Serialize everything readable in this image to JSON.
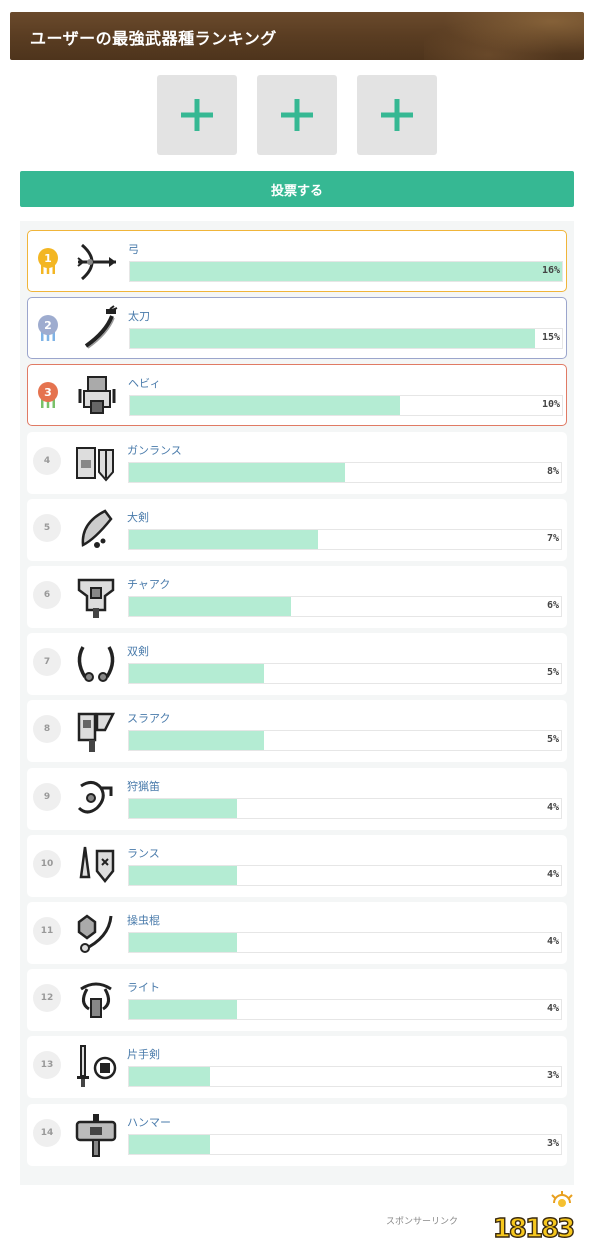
{
  "header": {
    "title": "ユーザーの最強武器種ランキング"
  },
  "slots": [
    {
      "icon": "plus-icon"
    },
    {
      "icon": "plus-icon"
    },
    {
      "icon": "plus-icon"
    }
  ],
  "vote_button": {
    "label": "投票する"
  },
  "colors": {
    "accent": "#36b893",
    "bar": "#b4ecd3",
    "gold": "#f0b53a",
    "silver": "#9ba5cc",
    "bronze": "#e07a64"
  },
  "ranking": [
    {
      "rank": "1",
      "name": "弓",
      "percent": 16,
      "percent_label": "16%",
      "icon": "bow-icon"
    },
    {
      "rank": "2",
      "name": "太刀",
      "percent": 15,
      "percent_label": "15%",
      "icon": "long-sword-icon"
    },
    {
      "rank": "3",
      "name": "ヘビィ",
      "percent": 10,
      "percent_label": "10%",
      "icon": "heavy-bowgun-icon"
    },
    {
      "rank": "4",
      "name": "ガンランス",
      "percent": 8,
      "percent_label": "8%",
      "icon": "gunlance-icon"
    },
    {
      "rank": "5",
      "name": "大剣",
      "percent": 7,
      "percent_label": "7%",
      "icon": "great-sword-icon"
    },
    {
      "rank": "6",
      "name": "チャアク",
      "percent": 6,
      "percent_label": "6%",
      "icon": "charge-blade-icon"
    },
    {
      "rank": "7",
      "name": "双剣",
      "percent": 5,
      "percent_label": "5%",
      "icon": "dual-blades-icon"
    },
    {
      "rank": "8",
      "name": "スラアク",
      "percent": 5,
      "percent_label": "5%",
      "icon": "switch-axe-icon"
    },
    {
      "rank": "9",
      "name": "狩猟笛",
      "percent": 4,
      "percent_label": "4%",
      "icon": "hunting-horn-icon"
    },
    {
      "rank": "10",
      "name": "ランス",
      "percent": 4,
      "percent_label": "4%",
      "icon": "lance-icon"
    },
    {
      "rank": "11",
      "name": "操虫棍",
      "percent": 4,
      "percent_label": "4%",
      "icon": "insect-glaive-icon"
    },
    {
      "rank": "12",
      "name": "ライト",
      "percent": 4,
      "percent_label": "4%",
      "icon": "light-bowgun-icon"
    },
    {
      "rank": "13",
      "name": "片手剣",
      "percent": 3,
      "percent_label": "3%",
      "icon": "sword-and-shield-icon"
    },
    {
      "rank": "14",
      "name": "ハンマー",
      "percent": 3,
      "percent_label": "3%",
      "icon": "hammer-icon"
    }
  ],
  "footer": {
    "sponsor": "スポンサーリンク",
    "logo_text": "18183"
  }
}
